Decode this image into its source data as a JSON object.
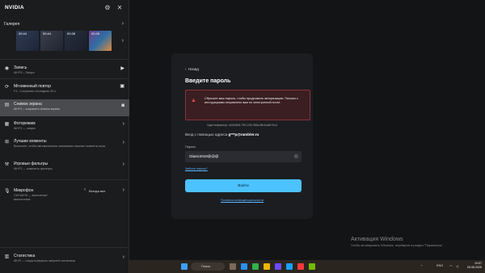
{
  "panel": {
    "brand": "NVIDIA",
    "gallery": {
      "title": "Галерея",
      "thumbs": [
        "00:44",
        "00:38",
        "00:45"
      ]
    },
    "rows": [
      {
        "title": "Запись",
        "sub": "Alt+F9 – Запуск",
        "right": "▶"
      },
      {
        "title": "Мгновенный повтор",
        "sub": "F4 - Сохранить последние 40 s",
        "right": "💾"
      },
      {
        "title": "Снимок экрана",
        "sub": "Alt+F1 – сохранить снимок экрана",
        "right": "📷"
      },
      {
        "title": "Фоторежим",
        "sub": "Alt+F2 — запуск",
        "right": "›"
      },
      {
        "title": "Лучшие моменты",
        "sub": "Включите, чтобы автоматически записывать важные моменты игры",
        "right": "›"
      },
      {
        "title": "Игровые фильтры",
        "sub": "Alt+F3 — изменить фильтры",
        "right": "›"
      },
      {
        "title": "Микрофон",
        "sub": "Ctrl+Alt+M — включение/выключение",
        "right": "Всегда вкл."
      },
      {
        "title": "Статистика",
        "sub": "Alt+R — открыть/закрыть оверлей статистики",
        "right": "›"
      }
    ]
  },
  "dialog": {
    "back": "Назад",
    "title": "Введите пароль",
    "alert": "Сбросьте ваш пароль, чтобы продолжить авторизацию. Письмо с инструкциями отправлено вам по электронной почте.",
    "ident": "Идентификатор: a0d1f6e8-79f1-f1f0-986a-8fb4ca6b70cd",
    "login_prefix": "Вход с помощью адреса",
    "login_email": "g***p@rambler.ru",
    "password_label": "Пароль",
    "password_value": "Glaniz2019@@@",
    "forgot": "Забыли пароль?",
    "submit": "Войти",
    "policy": "Политика конфиденциальности"
  },
  "activation": {
    "title": "Активация Windows",
    "sub": "Чтобы активировать Windows, перейдите в раздел \"Параметры\"."
  },
  "taskbar": {
    "search_placeholder": "Поиск",
    "lang": "ENG",
    "time": "19:57",
    "date": "05.08.2025"
  }
}
